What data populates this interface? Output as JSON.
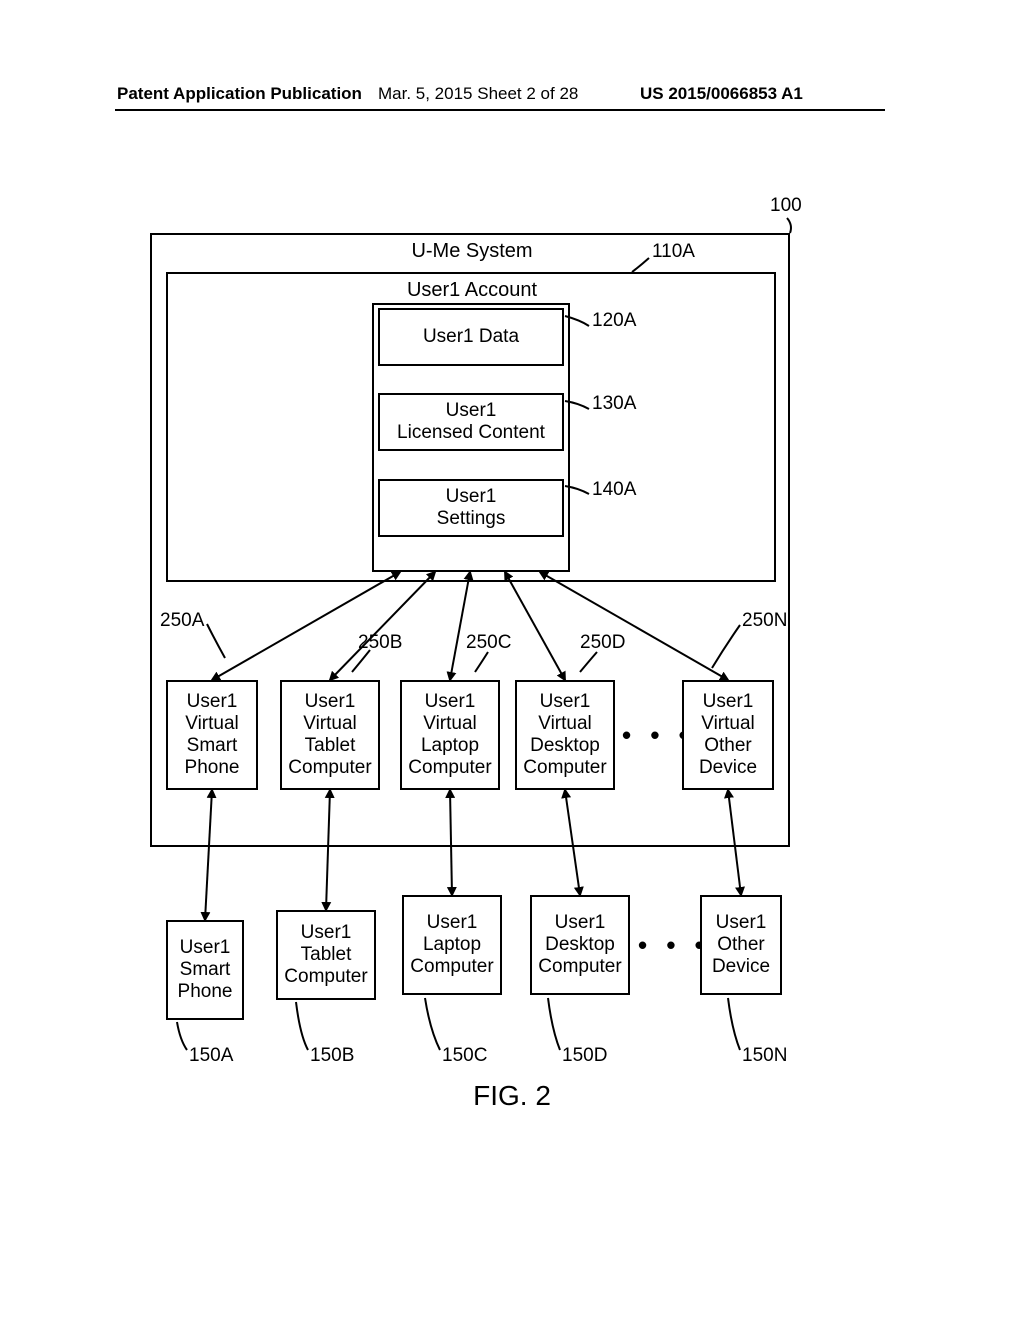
{
  "header": {
    "left": "Patent Application Publication",
    "mid": "Mar. 5, 2015  Sheet 2 of 28",
    "right": "US 2015/0066853 A1"
  },
  "refs": {
    "r100": "100",
    "r110A": "110A",
    "r120A": "120A",
    "r130A": "130A",
    "r140A": "140A",
    "r250A": "250A",
    "r250B": "250B",
    "r250C": "250C",
    "r250D": "250D",
    "r250N": "250N",
    "r150A": "150A",
    "r150B": "150B",
    "r150C": "150C",
    "r150D": "150D",
    "r150N": "150N"
  },
  "titles": {
    "system": "U-Me System",
    "account": "User1 Account"
  },
  "boxes": {
    "data": "User1 Data",
    "licensed1": "User1",
    "licensed2": "Licensed Content",
    "settings1": "User1",
    "settings2": "Settings",
    "v_sp_1": "User1",
    "v_sp_2": "Virtual",
    "v_sp_3": "Smart",
    "v_sp_4": "Phone",
    "v_tc_1": "User1",
    "v_tc_2": "Virtual",
    "v_tc_3": "Tablet",
    "v_tc_4": "Computer",
    "v_lc_1": "User1",
    "v_lc_2": "Virtual",
    "v_lc_3": "Laptop",
    "v_lc_4": "Computer",
    "v_dc_1": "User1",
    "v_dc_2": "Virtual",
    "v_dc_3": "Desktop",
    "v_dc_4": "Computer",
    "v_od_1": "User1",
    "v_od_2": "Virtual",
    "v_od_3": "Other",
    "v_od_4": "Device",
    "p_sp_1": "User1",
    "p_sp_2": "Smart",
    "p_sp_3": "Phone",
    "p_tc_1": "User1",
    "p_tc_2": "Tablet",
    "p_tc_3": "Computer",
    "p_lc_1": "User1",
    "p_lc_2": "Laptop",
    "p_lc_3": "Computer",
    "p_dc_1": "User1",
    "p_dc_2": "Desktop",
    "p_dc_3": "Computer",
    "p_od_1": "User1",
    "p_od_2": "Other",
    "p_od_3": "Device"
  },
  "dots": "•  •  •",
  "figure": "FIG. 2"
}
